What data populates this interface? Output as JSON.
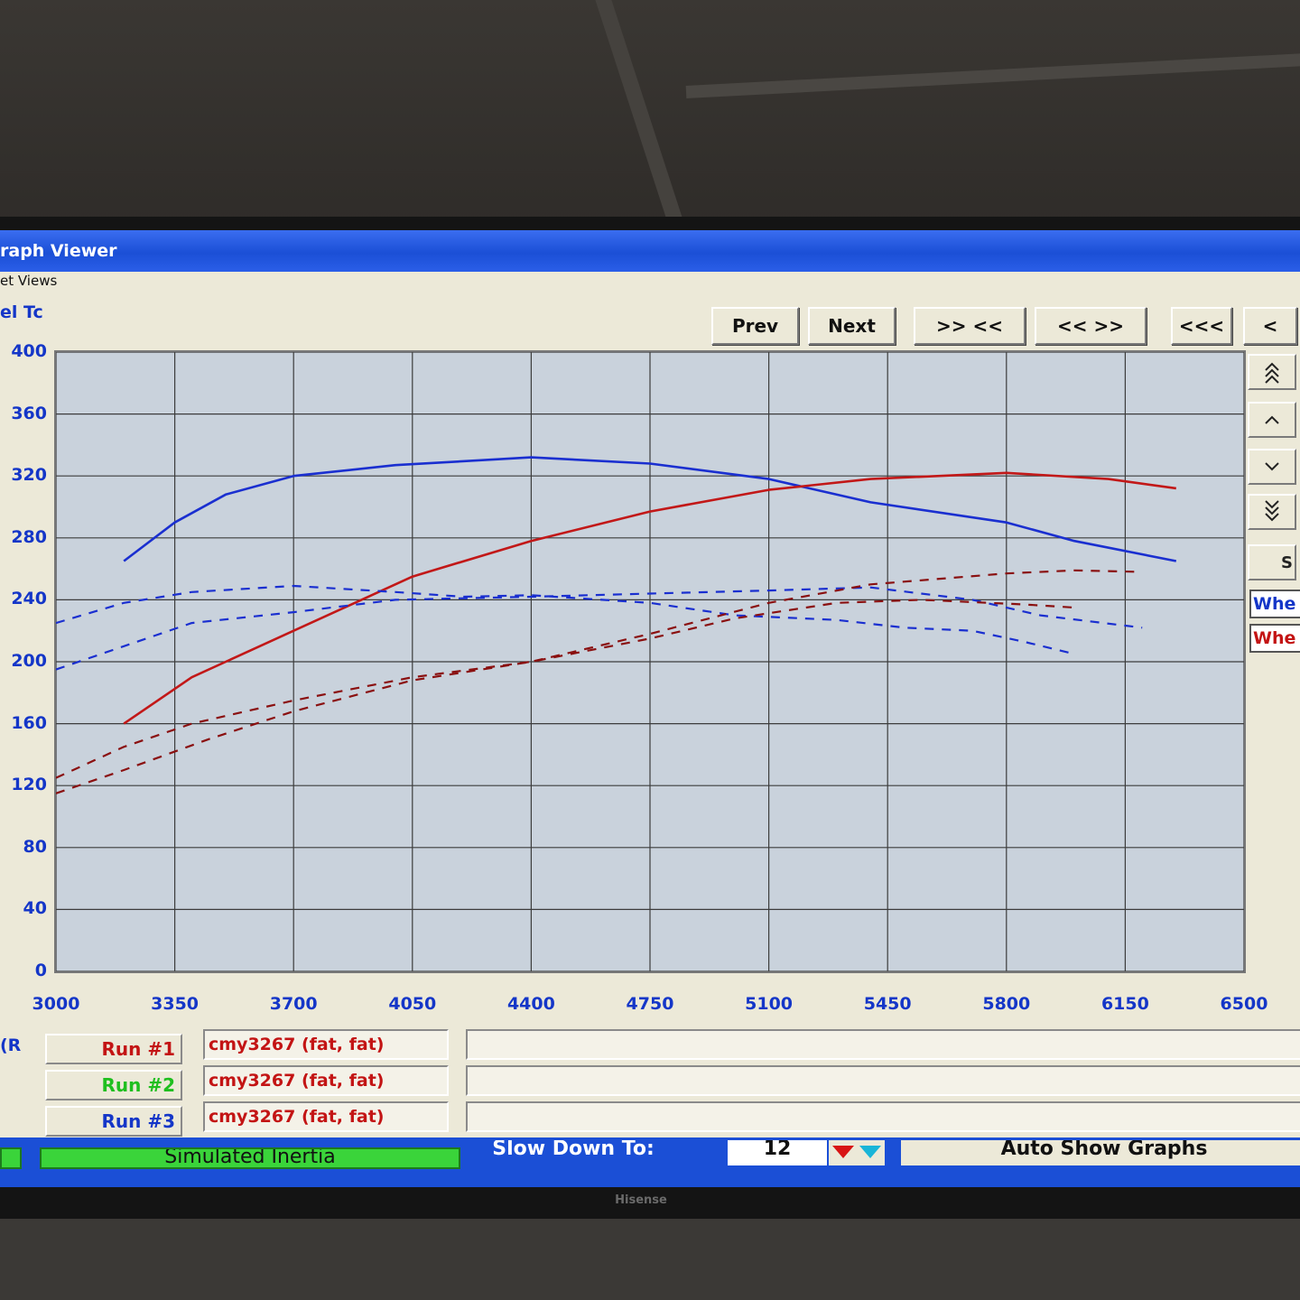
{
  "window": {
    "title": "raph Viewer",
    "menu": "et Views"
  },
  "left_axis_label": "el Tc",
  "nav_buttons": [
    {
      "label": "Prev"
    },
    {
      "label": "Next"
    },
    {
      "label": ">> <<"
    },
    {
      "label": "<< >>"
    },
    {
      "label": "<<<"
    },
    {
      "label": "<"
    }
  ],
  "side_controls": {
    "buttons": [
      "double-chevron-up-icon",
      "chevron-up-icon",
      "chevron-down-icon",
      "double-chevron-down-icon"
    ],
    "frag": "S",
    "legend_boxes": [
      {
        "label": "Whe",
        "color": "#1436c8"
      },
      {
        "label": "Whe",
        "color": "#c31414"
      }
    ]
  },
  "runs": [
    {
      "label": "Run #1",
      "color": "#c31414",
      "name": "cmy3267 (fat, fat)"
    },
    {
      "label": "Run #2",
      "color": "#1fbf1f",
      "name": "cmy3267 (fat, fat)"
    },
    {
      "label": "Run #3",
      "color": "#1436c8",
      "name": "cmy3267 (fat, fat)"
    }
  ],
  "runs_left_fragment": "(R",
  "status_bar": {
    "inertia_label": "Simulated Inertia",
    "slowdown_label": "Slow Down To:",
    "slowdown_value": "12",
    "auto_show_label": "Auto Show Graphs"
  },
  "monitor_brand": "Hisense",
  "chart_data": {
    "type": "line",
    "xlim": [
      3000,
      6500
    ],
    "ylim": [
      0,
      400
    ],
    "x_ticks": [
      "3000",
      "3350",
      "3700",
      "4050",
      "4400",
      "4750",
      "5100",
      "5450",
      "5800",
      "6150",
      "6500"
    ],
    "y_ticks": [
      "0",
      "40",
      "80",
      "120",
      "160",
      "200",
      "240",
      "280",
      "320",
      "360",
      "400"
    ],
    "grid": true,
    "series": [
      {
        "color": "#1a2fd0",
        "style": "solid",
        "points": [
          [
            3200,
            265
          ],
          [
            3350,
            290
          ],
          [
            3500,
            308
          ],
          [
            3700,
            320
          ],
          [
            4000,
            327
          ],
          [
            4400,
            332
          ],
          [
            4750,
            328
          ],
          [
            5100,
            318
          ],
          [
            5400,
            303
          ],
          [
            5800,
            290
          ],
          [
            6000,
            278
          ],
          [
            6300,
            265
          ]
        ]
      },
      {
        "color": "#c21818",
        "style": "solid",
        "points": [
          [
            3200,
            160
          ],
          [
            3400,
            190
          ],
          [
            3700,
            220
          ],
          [
            4050,
            255
          ],
          [
            4400,
            278
          ],
          [
            4750,
            297
          ],
          [
            5100,
            311
          ],
          [
            5400,
            318
          ],
          [
            5800,
            322
          ],
          [
            6100,
            318
          ],
          [
            6300,
            312
          ]
        ]
      },
      {
        "color": "#1a2fd0",
        "style": "dashed",
        "points": [
          [
            3000,
            225
          ],
          [
            3200,
            238
          ],
          [
            3400,
            245
          ],
          [
            3700,
            249
          ],
          [
            4000,
            245
          ],
          [
            4200,
            242
          ],
          [
            4400,
            243
          ],
          [
            4750,
            238
          ],
          [
            5000,
            230
          ],
          [
            5300,
            227
          ],
          [
            5500,
            222
          ],
          [
            5700,
            220
          ],
          [
            5850,
            213
          ],
          [
            6000,
            205
          ]
        ]
      },
      {
        "color": "#1a2fd0",
        "style": "dashed",
        "points": [
          [
            3000,
            195
          ],
          [
            3200,
            210
          ],
          [
            3400,
            225
          ],
          [
            3700,
            232
          ],
          [
            4000,
            240
          ],
          [
            4400,
            242
          ],
          [
            4750,
            244
          ],
          [
            5100,
            246
          ],
          [
            5400,
            248
          ],
          [
            5700,
            240
          ],
          [
            5900,
            230
          ],
          [
            6200,
            222
          ]
        ]
      },
      {
        "color": "#8a1010",
        "style": "dashed",
        "points": [
          [
            3000,
            125
          ],
          [
            3200,
            145
          ],
          [
            3400,
            160
          ],
          [
            3700,
            175
          ],
          [
            4050,
            190
          ],
          [
            4400,
            200
          ],
          [
            4750,
            215
          ],
          [
            5000,
            228
          ],
          [
            5300,
            238
          ],
          [
            5550,
            240
          ],
          [
            5850,
            237
          ],
          [
            6000,
            235
          ]
        ]
      },
      {
        "color": "#8a1010",
        "style": "dashed",
        "points": [
          [
            3000,
            115
          ],
          [
            3200,
            130
          ],
          [
            3450,
            150
          ],
          [
            3700,
            168
          ],
          [
            4050,
            188
          ],
          [
            4400,
            200
          ],
          [
            4750,
            218
          ],
          [
            5100,
            238
          ],
          [
            5400,
            250
          ],
          [
            5800,
            257
          ],
          [
            6000,
            259
          ],
          [
            6200,
            258
          ]
        ]
      }
    ]
  }
}
